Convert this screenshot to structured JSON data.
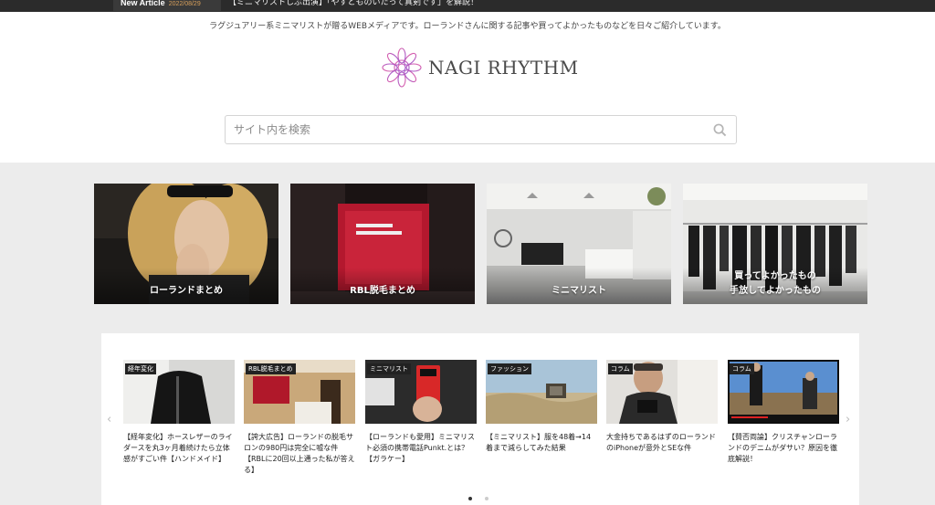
{
  "news": {
    "label": "New Article",
    "date": "2022/08/29",
    "headline": "【ミニマリストしぶ出演】「やすとものいたって真剣です」を解説！"
  },
  "header": {
    "tagline": "ラグジュアリー系ミニマリストが贈るWEBメディアです。ローランドさんに関する記事や買ってよかったものなどを日々ご紹介しています。",
    "site_name": "NAGI RHYTHM",
    "logo_icon": "mandala-logo-icon"
  },
  "search": {
    "placeholder": "サイト内を検索",
    "icon": "search-icon"
  },
  "categories": [
    {
      "label": "ローランドまとめ"
    },
    {
      "label": "RBL脱毛まとめ"
    },
    {
      "label": "ミニマリスト"
    },
    {
      "label_line1": "買ってよかったもの",
      "label_line2": "手放してよかったもの"
    }
  ],
  "carousel": {
    "prev_icon": "chevron-left-icon",
    "next_icon": "chevron-right-icon",
    "cards": [
      {
        "badge": "経年変化",
        "title": "【経年変化】ホースレザーのライダースを丸3ヶ月着続けたら立体感がすごい件【ハンドメイド】"
      },
      {
        "badge": "RBL脱毛まとめ",
        "title": "【誇大広告】ローランドの脱毛サロンの980円は完全に嘘な件【RBLに20回以上通った私が答える】"
      },
      {
        "badge": "ミニマリスト",
        "title": "【ローランドも愛用】ミニマリスト必須の携帯電話Punkt.とは？【ガラケー】"
      },
      {
        "badge": "ファッション",
        "title": "【ミニマリスト】服を48着→14着まで減らしてみた結果"
      },
      {
        "badge": "コラム",
        "title": "大金持ちであるはずのローランドのiPhoneが意外とSEな件"
      },
      {
        "badge": "コラム",
        "title": "【賛否両論】クリスチャンローランドのデニムがダサい？原因を徹底解説！"
      }
    ],
    "page_count": 2,
    "active_page": 1
  }
}
